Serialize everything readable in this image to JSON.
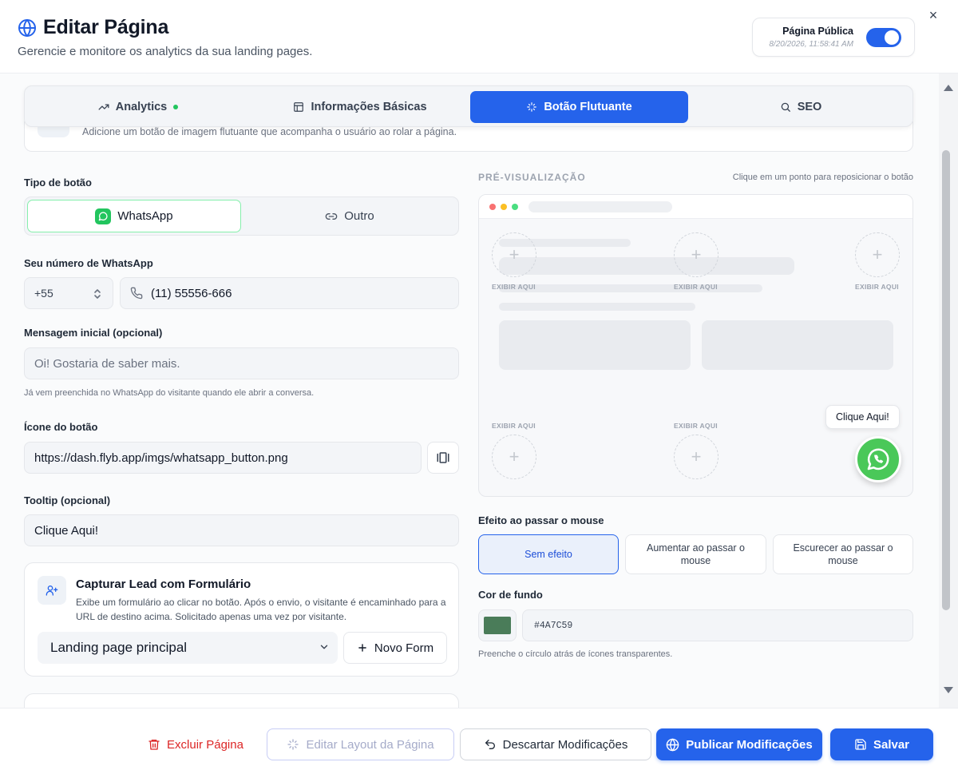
{
  "header": {
    "title": "Editar Página",
    "subtitle": "Gerencie e monitore os analytics da sua landing pages.",
    "public_label": "Página Pública",
    "public_timestamp": "8/20/2026, 11:58:41 AM",
    "public_enabled": true,
    "close_symbol": "×"
  },
  "tabs": [
    {
      "label": "Analytics",
      "icon": "trending-up-icon",
      "active": false,
      "status_dot": true
    },
    {
      "label": "Informações Básicas",
      "icon": "layout-icon",
      "active": false
    },
    {
      "label": "Botão Flutuante",
      "icon": "sparkles-icon",
      "active": true
    },
    {
      "label": "SEO",
      "icon": "search-icon",
      "active": false
    }
  ],
  "info_banner": "Adicione um botão de imagem flutuante que acompanha o usuário ao rolar a página.",
  "form": {
    "button_type_label": "Tipo de botão",
    "button_types": [
      {
        "label": "WhatsApp",
        "active": true
      },
      {
        "label": "Outro",
        "active": false
      }
    ],
    "whatsapp_label": "Seu número de WhatsApp",
    "country_code": "+55",
    "phone": "(11) 55556-666",
    "message_label": "Mensagem inicial (opcional)",
    "message_placeholder": "Oi! Gostaria de saber mais.",
    "message_hint": "Já vem preenchida no WhatsApp do visitante quando ele abrir a conversa.",
    "icon_label": "Ícone do botão",
    "icon_url": "https://dash.flyb.app/imgs/whatsapp_button.png",
    "tooltip_label": "Tooltip (opcional)",
    "tooltip_value": "Clique Aqui!"
  },
  "lead": {
    "title": "Capturar Lead com Formulário",
    "description": "Exibe um formulário ao clicar no botão. Após o envio, o visitante é encaminhado para a URL de destino acima. Solicitado apenas uma vez por visitante.",
    "selected_form": "Landing page principal",
    "new_form_label": "Novo Form"
  },
  "preview": {
    "heading": "PRÉ-VISUALIZAÇÃO",
    "hint": "Clique em um ponto para reposicionar o botão",
    "spot_label": "EXIBIR AQUI",
    "spot_symbol": "+",
    "tooltip": "Clique Aqui!"
  },
  "hover": {
    "label": "Efeito ao passar o mouse",
    "options": [
      {
        "label": "Sem efeito",
        "active": true
      },
      {
        "label": "Aumentar ao passar o mouse",
        "active": false
      },
      {
        "label": "Escurecer ao passar o mouse",
        "active": false
      }
    ]
  },
  "background": {
    "label": "Cor de fundo",
    "hex": "#4A7C59",
    "hint": "Preenche o círculo atrás de ícones transparentes."
  },
  "footer": {
    "delete": "Excluir Página",
    "edit_layout": "Editar Layout da Página",
    "discard": "Descartar Modificações",
    "publish": "Publicar Modificações",
    "save": "Salvar"
  },
  "colors": {
    "primary": "#2563eb",
    "danger": "#dc2626",
    "whatsapp": "#4ac859",
    "status_dot": "#22c55e",
    "swatch": "#4A7C59"
  }
}
